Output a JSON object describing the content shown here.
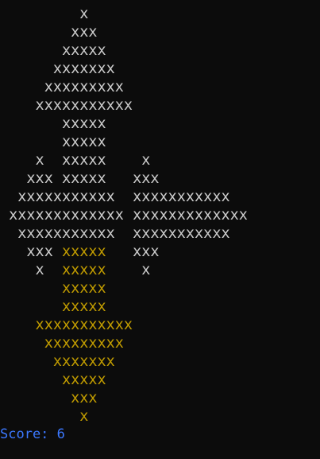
{
  "colors": {
    "background": "#0c0c0c",
    "white_piece": "#cccccc",
    "yellow_piece": "#c19c00",
    "score_text": "#3b78ff"
  },
  "board": {
    "rows": [
      [
        {
          "text": "         x",
          "color": "white"
        }
      ],
      [
        {
          "text": "        xxx",
          "color": "white"
        }
      ],
      [
        {
          "text": "       xxxxx",
          "color": "white"
        }
      ],
      [
        {
          "text": "      xxxxxxx",
          "color": "white"
        }
      ],
      [
        {
          "text": "     xxxxxxxxx",
          "color": "white"
        }
      ],
      [
        {
          "text": "    xxxxxxxxxxx",
          "color": "white"
        }
      ],
      [
        {
          "text": "       xxxxx",
          "color": "white"
        }
      ],
      [
        {
          "text": "       xxxxx",
          "color": "white"
        }
      ],
      [
        {
          "text": "    x  ",
          "color": "white"
        },
        {
          "text": "xxxxx",
          "color": "white"
        },
        {
          "text": "    x",
          "color": "white"
        }
      ],
      [
        {
          "text": "   xxx ",
          "color": "white"
        },
        {
          "text": "xxxxx",
          "color": "white"
        },
        {
          "text": "   xxx",
          "color": "white"
        }
      ],
      [
        {
          "text": "  xxxxxxxxxxx  ",
          "color": "white"
        },
        {
          "text": "xxxxxxxxxxx",
          "color": "white"
        }
      ],
      [
        {
          "text": " xxxxxxxxxxxxx ",
          "color": "white"
        },
        {
          "text": "xxxxxxxxxxxxx",
          "color": "white"
        }
      ],
      [
        {
          "text": "  xxxxxxxxxxx  ",
          "color": "white"
        },
        {
          "text": "xxxxxxxxxxx",
          "color": "white"
        }
      ],
      [
        {
          "text": "   xxx ",
          "color": "white"
        },
        {
          "text": "xxxxx",
          "color": "yellow"
        },
        {
          "text": "   xxx",
          "color": "white"
        }
      ],
      [
        {
          "text": "    x  ",
          "color": "white"
        },
        {
          "text": "xxxxx",
          "color": "yellow"
        },
        {
          "text": "    x",
          "color": "white"
        }
      ],
      [
        {
          "text": "       xxxxx",
          "color": "yellow"
        }
      ],
      [
        {
          "text": "       xxxxx",
          "color": "yellow"
        }
      ],
      [
        {
          "text": "    xxxxxxxxxxx",
          "color": "yellow"
        }
      ],
      [
        {
          "text": "     xxxxxxxxx",
          "color": "yellow"
        }
      ],
      [
        {
          "text": "      xxxxxxx",
          "color": "yellow"
        }
      ],
      [
        {
          "text": "       xxxxx",
          "color": "yellow"
        }
      ],
      [
        {
          "text": "        xxx",
          "color": "yellow"
        }
      ],
      [
        {
          "text": "         x",
          "color": "yellow"
        }
      ]
    ]
  },
  "status": {
    "score_label": "Score: 6"
  }
}
